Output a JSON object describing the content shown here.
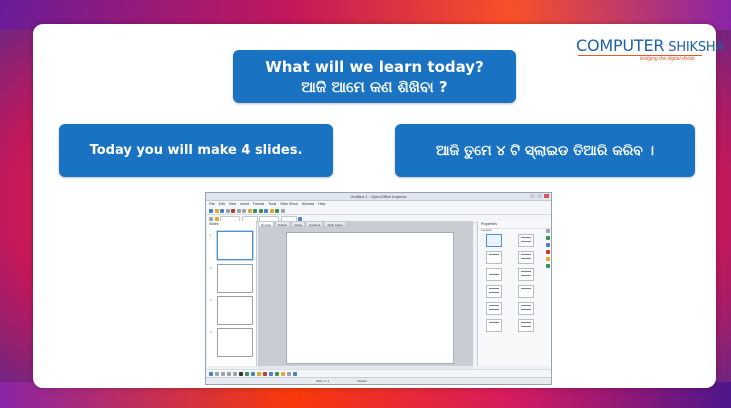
{
  "logo": {
    "brand_left": "COMPUTER",
    "brand_right": "SHIKSHA",
    "tagline": "bridging the digital divide"
  },
  "title_pill": {
    "line1": "What will we learn today?",
    "line2": "ଆଜି ଆମେ କଣ ଶିଖିବା ?"
  },
  "left_pill": {
    "text": "Today you will make 4 slides."
  },
  "right_pill": {
    "text": "ଆଜି ତୁମେ ୪ ଟି ସ୍ଲାଇଡ ତିଆରି କରିବ ।"
  },
  "app": {
    "window_title": "Untitled 1 - OpenOffice Impress",
    "menu": [
      "File",
      "Edit",
      "View",
      "Insert",
      "Format",
      "Tools",
      "Slide Show",
      "Window",
      "Help"
    ],
    "slides_pane_label": "Slides",
    "view_tabs": [
      "Normal",
      "Outline",
      "Notes",
      "Handout",
      "Slide Sorter"
    ],
    "properties_label": "Properties",
    "layouts_label": "Layouts",
    "status": [
      "Slide 1 / 1",
      "Default"
    ]
  },
  "colors": {
    "pill_bg": "#1a73c2",
    "brand_blue": "#1e5fa8",
    "brand_orange": "#e05a2a"
  }
}
